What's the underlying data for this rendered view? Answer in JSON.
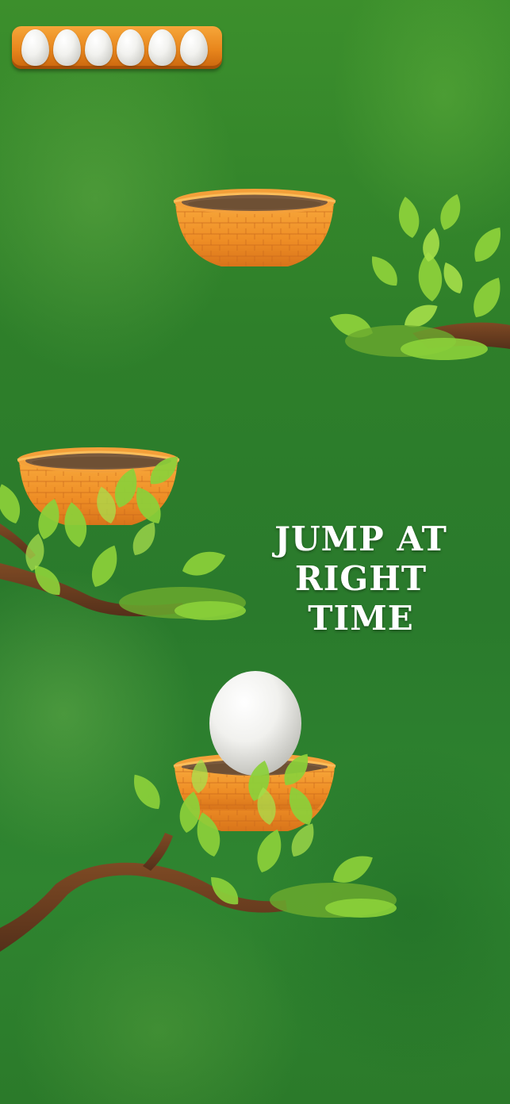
{
  "hud": {
    "lives_count": 6,
    "lives_icon": "egg-icon"
  },
  "instruction": {
    "line1": "JUMP AT",
    "line2": "RIGHT TIME"
  },
  "colors": {
    "background": "#2e7f2a",
    "basket": "#f0932a",
    "leaves": "#8fd23a",
    "branch": "#6b3f1f",
    "egg": "#f4f4f0",
    "hud_bar": "#e8861c"
  }
}
